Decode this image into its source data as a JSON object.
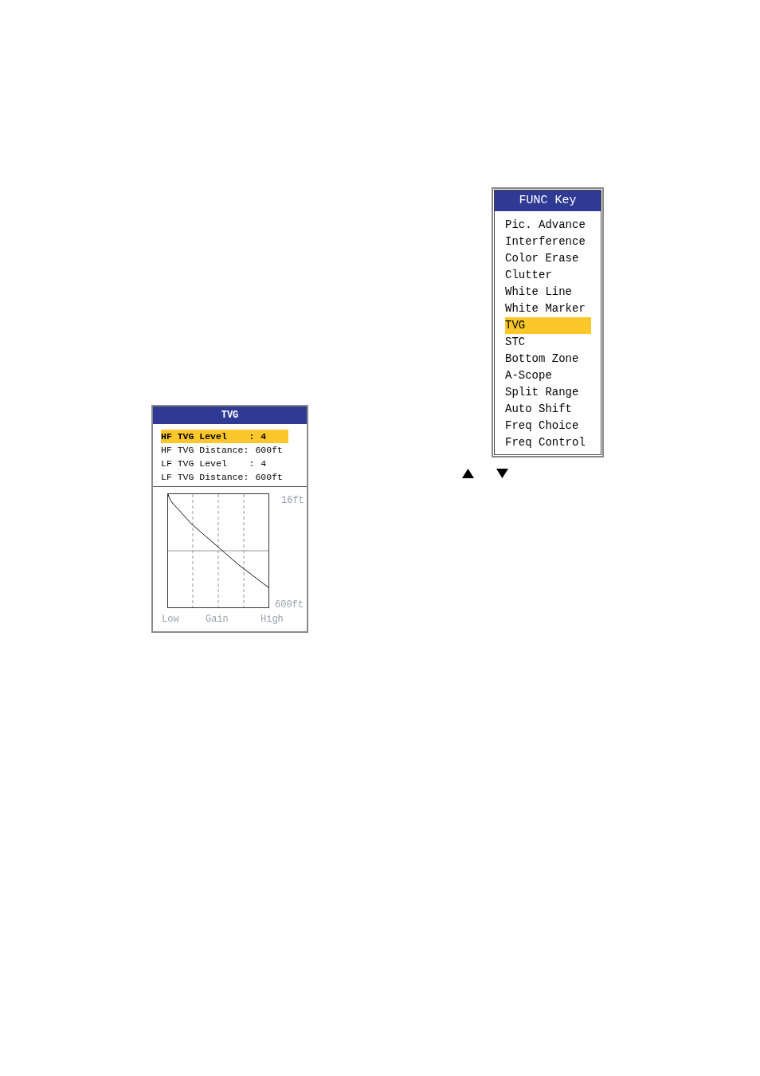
{
  "tvg_panel": {
    "title": "TVG",
    "settings": [
      {
        "label": "HF TVG Level    :",
        "value": "4",
        "selected": true
      },
      {
        "label": "HF TVG Distance:",
        "value": "600ft",
        "selected": false
      },
      {
        "label": "LF TVG Level    :",
        "value": "4",
        "selected": false
      },
      {
        "label": "LF TVG Distance:",
        "value": "600ft",
        "selected": false
      }
    ],
    "graph": {
      "top_label": "16ft",
      "bottom_label": "600ft",
      "x_labels": [
        "Low",
        "Gain",
        "High"
      ]
    }
  },
  "func_menu": {
    "title": "FUNC Key",
    "items": [
      {
        "label": "Pic. Advance",
        "selected": false
      },
      {
        "label": "Interference",
        "selected": false
      },
      {
        "label": "Color Erase",
        "selected": false
      },
      {
        "label": "Clutter",
        "selected": false
      },
      {
        "label": "White Line",
        "selected": false
      },
      {
        "label": "White Marker",
        "selected": false
      },
      {
        "label": "TVG",
        "selected": true
      },
      {
        "label": "STC",
        "selected": false
      },
      {
        "label": "Bottom Zone",
        "selected": false
      },
      {
        "label": "A-Scope",
        "selected": false
      },
      {
        "label": "Split Range",
        "selected": false
      },
      {
        "label": "Auto Shift",
        "selected": false
      },
      {
        "label": "Freq Choice",
        "selected": false
      },
      {
        "label": "Freq Control",
        "selected": false
      }
    ]
  }
}
